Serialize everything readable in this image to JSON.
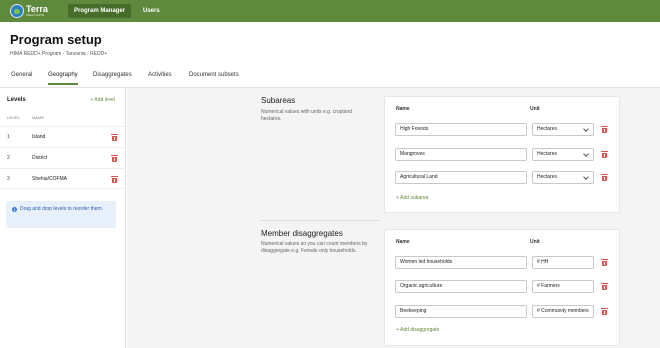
{
  "topbar": {
    "logo_text": "Terra",
    "logo_sub": "FIELD SUITE",
    "nav": [
      "Program Manager",
      "Users"
    ]
  },
  "header": {
    "title": "Program setup",
    "breadcrumb": "HIMA REDD+ Program - Tanzania - REDD+"
  },
  "tabs": [
    "General",
    "Geography",
    "Disaggregates",
    "Activities",
    "Document subsets"
  ],
  "sidebar": {
    "title": "Levels",
    "add_label": "+ Add level",
    "col_level": "LEVEL",
    "col_name": "NAME",
    "rows": [
      {
        "level": "1",
        "name": "Island"
      },
      {
        "level": "2",
        "name": "District"
      },
      {
        "level": "3",
        "name": "Shehia/COFMA"
      }
    ],
    "info": "Drag and drop levels to reorder them."
  },
  "subareas": {
    "title": "Subareas",
    "desc": "Numerical values with units e.g. cropland hectares.",
    "col_name": "Name",
    "col_unit": "Unit",
    "rows": [
      {
        "name": "High Forests",
        "unit": "Hectares"
      },
      {
        "name": "Mangroves",
        "unit": "Hectares"
      },
      {
        "name": "Agricultural Land",
        "unit": "Hectares"
      }
    ],
    "add_label": "+ Add subarea"
  },
  "members": {
    "title": "Member disaggregates",
    "desc": "Numerical values so you can count members by disaggregate e.g. Female only households.",
    "col_name": "Name",
    "col_unit": "Unit",
    "rows": [
      {
        "name": "Women led households",
        "unit": "# HH"
      },
      {
        "name": "Organic agriculture",
        "unit": "# Farmers"
      },
      {
        "name": "Beekeeping",
        "unit": "# Community members"
      }
    ],
    "add_label": "+ Add disaggregate"
  },
  "colors": {
    "brand": "#5f8a3d",
    "danger": "#d9534f",
    "info": "#3b7dd8"
  }
}
